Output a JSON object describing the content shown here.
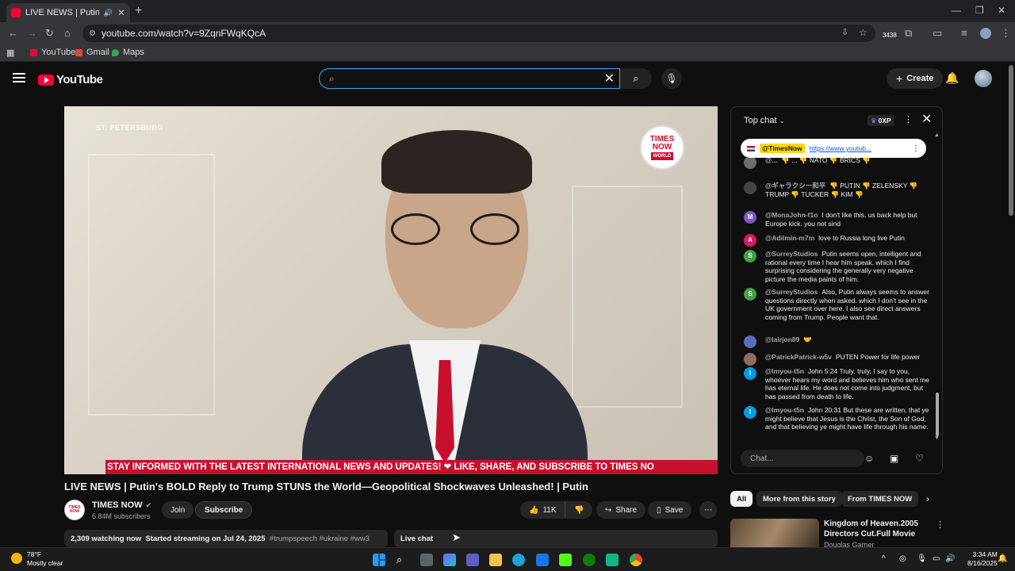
{
  "browser": {
    "tab_title": "LIVE NEWS | Putin's BOLD R",
    "url": "youtube.com/watch?v=9ZqnFWqKQcA",
    "ext_badge": "3438",
    "bookmarks": [
      "YouTube",
      "Gmail",
      "Maps"
    ]
  },
  "header": {
    "logo_text": "YouTube",
    "search_value": "",
    "create_label": "Create"
  },
  "video": {
    "location_overlay": "ST. PETERSBURG",
    "channel_logo_line1": "TIMES",
    "channel_logo_line2": "NOW",
    "channel_logo_line3": "WORLD",
    "ticker": "STAY INFORMED WITH THE LATEST INTERNATIONAL NEWS AND UPDATES! ❤ LIKE, SHARE, AND SUBSCRIBE TO TIMES NO",
    "title": "LIVE NEWS | Putin's BOLD Reply to Trump STUNS the World—Geopolitical Shockwaves Unleashed! | Putin",
    "channel_name": "TIMES NOW",
    "subscribers": "6.84M subscribers",
    "join_label": "Join",
    "subscribe_label": "Subscribe",
    "likes": "11K",
    "share_label": "Share",
    "save_label": "Save",
    "watching": "2,309 watching now",
    "started": "Started streaming on Jul 24, 2025",
    "tags": "#trumpspeech #ukraine #ww3",
    "livechat_label": "Live chat"
  },
  "chat": {
    "mode_label": "Top chat",
    "xp_label": "0XP",
    "pinned_author": "@TimesNow",
    "pinned_link": "https://www.youtub...",
    "input_placeholder": "Chat...",
    "messages": [
      {
        "author": "@...",
        "text": "👎 ... 👎 NATO 👎 BRICS 👎",
        "initial": "",
        "color": "#6d6d6d"
      },
      {
        "author": "@ギャラクシー和平",
        "text": "👎 PUTIN 👎 ZELENSKY 👎 TRUMP 👎 TUCKER 👎 KIM 👎",
        "initial": "",
        "color": "#444"
      },
      {
        "author": "@MonaJohn-f1o",
        "text": "I don't like this. us back help but Europe kick. you not sind",
        "initial": "M",
        "color": "#7e57c2"
      },
      {
        "author": "@Adilmin-m7m",
        "text": "love to Russia long live Putin",
        "initial": "A",
        "color": "#d81b60"
      },
      {
        "author": "@SurreyStudios",
        "text": "Putin seems open, intelligent and rational every time I hear him speak. which I find surprising considering the generally very negative picture the media paints of him.",
        "initial": "S",
        "color": "#43a047"
      },
      {
        "author": "@SurreyStudios",
        "text": "Also, Putin always seems to answer questions directly when asked. which I don't see in the UK government over here. I also see direct answers coming from Trump. People want that.",
        "initial": "S",
        "color": "#43a047"
      },
      {
        "author": "@lairjon89",
        "text": "🤝",
        "initial": "",
        "color": "#5c6bc0"
      },
      {
        "author": "@PatrickPatrick-w5v",
        "text": "PUTEN Power for life power",
        "initial": "",
        "color": "#8d6e63"
      },
      {
        "author": "@lmyou-t5n",
        "text": "John 5:24 Truly, truly, I say to you, whoever hears my word and believes him who sent me has eternal life. He does not come into judgment, but has passed from death to life.",
        "initial": "I",
        "color": "#039be5"
      },
      {
        "author": "@lmyou-t5n",
        "text": "John 20:31 But these are written, that ye might believe that Jesus is the Christ, the Son of God; and that believing ye might have life through his name.",
        "initial": "I",
        "color": "#039be5"
      }
    ]
  },
  "recommendations": {
    "chips": [
      "All",
      "More from this story",
      "From TIMES NOW"
    ],
    "items": [
      {
        "title": "Kingdom of Heaven.2005 Directors Cut.Full Movie",
        "channel": "Douglas Garner"
      }
    ]
  },
  "taskbar": {
    "temp": "78°F",
    "weather": "Mostly clear",
    "time": "3:34 AM",
    "date": "8/16/2025"
  },
  "colors": {
    "accent_red": "#ff0033",
    "ticker_red": "#c8102e",
    "search_focus": "#3ea6ff"
  }
}
